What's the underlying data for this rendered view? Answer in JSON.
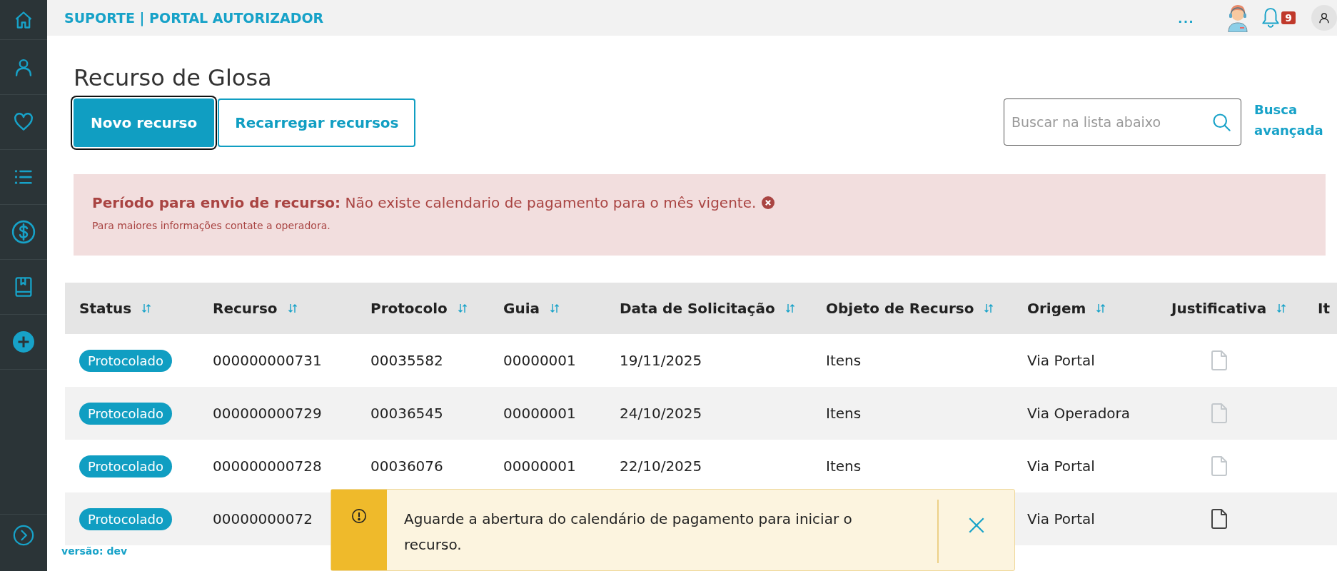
{
  "header": {
    "title": "SUPORTE | PORTAL AUTORIZADOR",
    "more": "...",
    "notification_count": "9"
  },
  "page_title": "Recurso de Glosa",
  "buttons": [
    {
      "label": "Novo recurso",
      "kind": "primary",
      "focused": true
    },
    {
      "label": "Recarregar recursos",
      "kind": "secondary",
      "focused": false
    }
  ],
  "search": {
    "placeholder": "Buscar na lista abaixo"
  },
  "advanced_search": "Busca avançada",
  "alert": {
    "message": "**Período para envio de recurso:** Não existe calendario de pagamento para o mês vigente.",
    "detail": "Para maiores informações contate a operadora."
  },
  "table": {
    "columns": [
      {
        "label": "Status",
        "sortable": true
      },
      {
        "label": "Recurso",
        "sortable": true
      },
      {
        "label": "Protocolo",
        "sortable": true
      },
      {
        "label": "Guia",
        "sortable": true
      },
      {
        "label": "Data de Solicitação",
        "sortable": true
      },
      {
        "label": "Objeto de Recurso",
        "sortable": true
      },
      {
        "label": "Origem",
        "sortable": true
      },
      {
        "label": "Justificativa",
        "sortable": true
      },
      {
        "label": "It",
        "sortable": false
      }
    ],
    "rows": [
      {
        "status": "Protocolado",
        "recurso": "000000000731",
        "protocolo": "00035582",
        "guia": "00000001",
        "data": "19/11/2025",
        "objeto": "Itens",
        "origem": "Via Portal",
        "justificativa_available": false
      },
      {
        "status": "Protocolado",
        "recurso": "000000000729",
        "protocolo": "00036545",
        "guia": "00000001",
        "data": "24/10/2025",
        "objeto": "Itens",
        "origem": "Via Operadora",
        "justificativa_available": false
      },
      {
        "status": "Protocolado",
        "recurso": "000000000728",
        "protocolo": "00036076",
        "guia": "00000001",
        "data": "22/10/2025",
        "objeto": "Itens",
        "origem": "Via Portal",
        "justificativa_available": false
      },
      {
        "status": "Protocolado",
        "recurso": "00000000072",
        "origem": "Via Portal",
        "justificativa_available": true
      }
    ]
  },
  "toast": {
    "message": "Aguarde a abertura do calendário de pagamento para iniciar o recurso."
  },
  "version": "versão: dev"
}
